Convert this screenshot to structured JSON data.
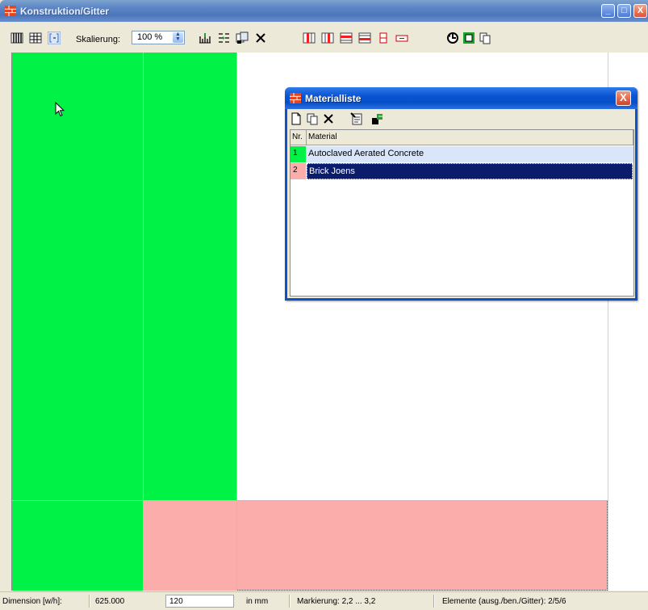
{
  "window": {
    "title": "Konstruktion/Gitter",
    "minimize": "_",
    "maximize": "□",
    "close": "X"
  },
  "toolbar": {
    "scale_label": "Skalierung:",
    "scale_value": "100 %"
  },
  "canvas": {
    "colors": {
      "green": "#00f246",
      "pink": "#fbadac"
    }
  },
  "dialog": {
    "title": "Materialliste",
    "close": "X",
    "columns": {
      "nr": "Nr.",
      "material": "Material"
    },
    "rows": [
      {
        "nr": "1",
        "material": "Autoclaved Aerated Concrete",
        "nr_color": "#00f246",
        "selected": false
      },
      {
        "nr": "2",
        "material": "Brick Joens",
        "nr_color": "#fbadac",
        "selected": true
      }
    ]
  },
  "statusbar": {
    "dimension_label": "Dimension [w/h]:",
    "width_value": "625.000",
    "height_value": "120",
    "unit": "in mm",
    "marking": "Markierung: 2,2 ... 3,2",
    "elements": "Elemente (ausg./ben./Gitter): 2/5/6"
  }
}
